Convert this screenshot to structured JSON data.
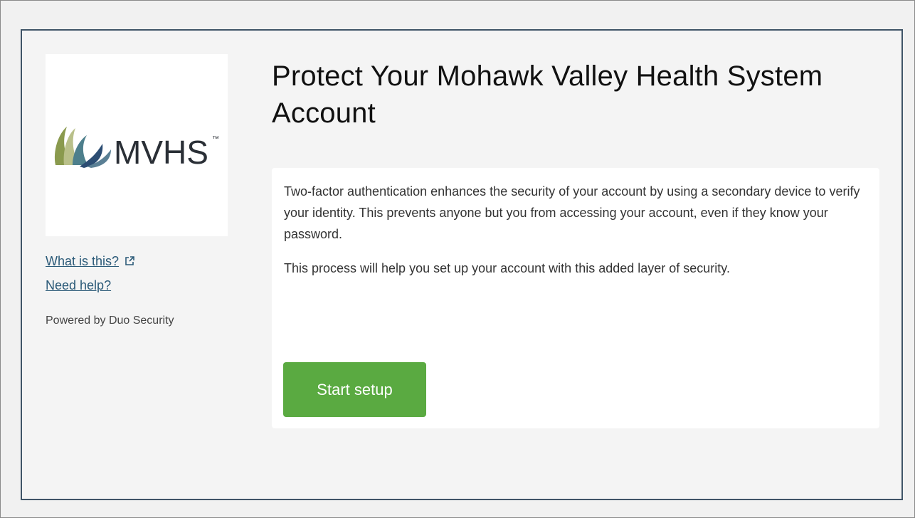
{
  "sidebar": {
    "logo": {
      "wordmark": "MVHS",
      "trademark": "™",
      "colors": {
        "leaf_green": "#8a9a4e",
        "leaf_light": "#b9c08a",
        "leaf_blue": "#2c4d73",
        "leaf_teal": "#4d7f8c",
        "wordmark": "#2a2f36"
      }
    },
    "what_is_this_label": "What is this?",
    "need_help_label": "Need help?",
    "powered_by": "Powered by Duo Security",
    "link_color": "#2b5a78"
  },
  "main": {
    "title": "Protect Your Mohawk Valley Health System Account",
    "paragraphs": [
      "Two-factor authentication enhances the security of your account by using a secondary device to verify your identity. This prevents anyone but you from accessing your account, even if they know your password.",
      "This process will help you set up your account with this added layer of security."
    ],
    "start_button_label": "Start setup",
    "start_button_color": "#5aaa41"
  },
  "icons": {
    "external_link": "external-link-icon"
  }
}
